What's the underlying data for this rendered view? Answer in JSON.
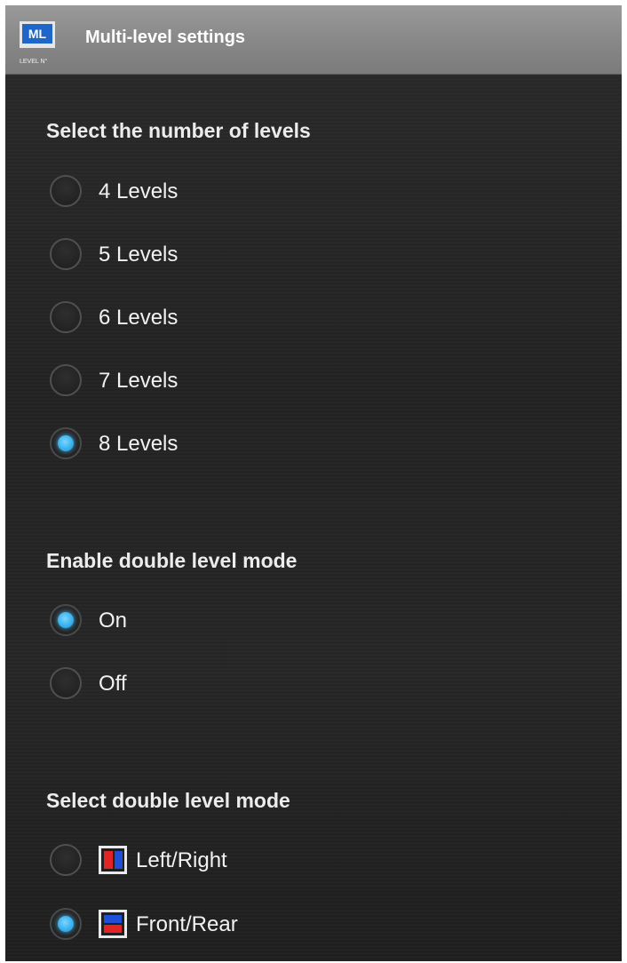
{
  "app": {
    "logo_text": "ML",
    "logo_caption": "LEVEL N°",
    "title": "Multi-level settings"
  },
  "levels": {
    "heading": "Select the number of levels",
    "selected": "8 Levels",
    "options": [
      {
        "label": "4 Levels",
        "checked": false
      },
      {
        "label": "5 Levels",
        "checked": false
      },
      {
        "label": "6 Levels",
        "checked": false
      },
      {
        "label": "7 Levels",
        "checked": false
      },
      {
        "label": "8 Levels",
        "checked": true
      }
    ]
  },
  "double_level": {
    "heading": "Enable double level mode",
    "selected": "On",
    "options": [
      {
        "label": "On",
        "checked": true
      },
      {
        "label": "Off",
        "checked": false
      }
    ]
  },
  "double_mode": {
    "heading": "Select double level mode",
    "selected": "Front/Rear",
    "options": [
      {
        "label": "Left/Right",
        "icon": "split-vertical-icon",
        "checked": false
      },
      {
        "label": "Front/Rear",
        "icon": "split-horizontal-icon",
        "checked": true
      }
    ]
  },
  "colors": {
    "radio_selected": "#38b3ee",
    "split_red": "#e32424",
    "split_blue": "#1f4fd8",
    "title_bar": "#8a8a8a",
    "background": "#262626"
  }
}
